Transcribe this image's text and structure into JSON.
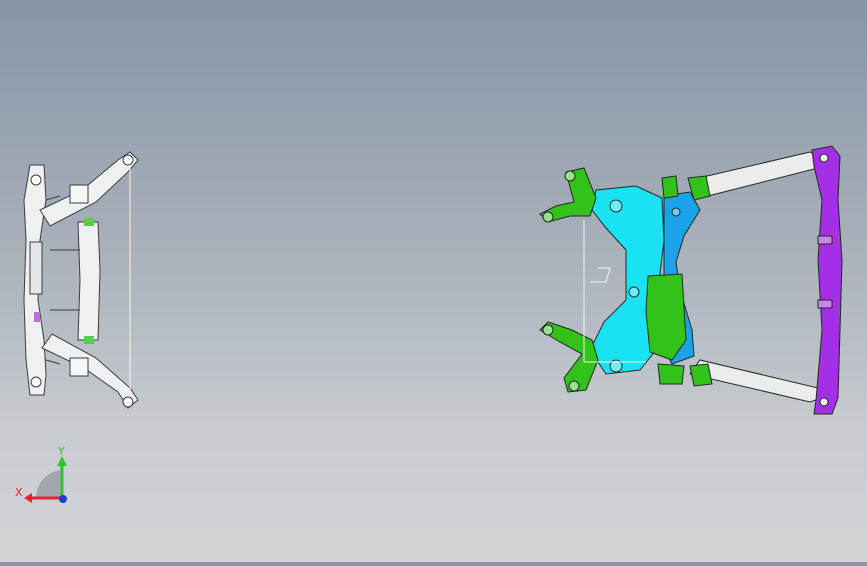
{
  "app": {
    "window_title": ""
  },
  "viewport": {
    "background_top": "#8795a6",
    "background_bottom": "#d2d4d7",
    "models": [
      {
        "name": "subframe-wireframe-view",
        "style": "white-line-drawing"
      },
      {
        "name": "subframe-colored-view",
        "style": "shaded-parts"
      }
    ],
    "part_colors": {
      "wireframe": "#f2f2f2",
      "cyan_bracket": "#19e3f2",
      "blue_bracket": "#1aa3e8",
      "green_bracket": "#33c21a",
      "purple_beam": "#a52fe6",
      "crossbar": "#ececec"
    }
  },
  "triad": {
    "x_label": "X",
    "y_label": "Y",
    "x_color": "#e0262c",
    "y_color": "#2cc52c",
    "z_color": "#1b3be0"
  }
}
